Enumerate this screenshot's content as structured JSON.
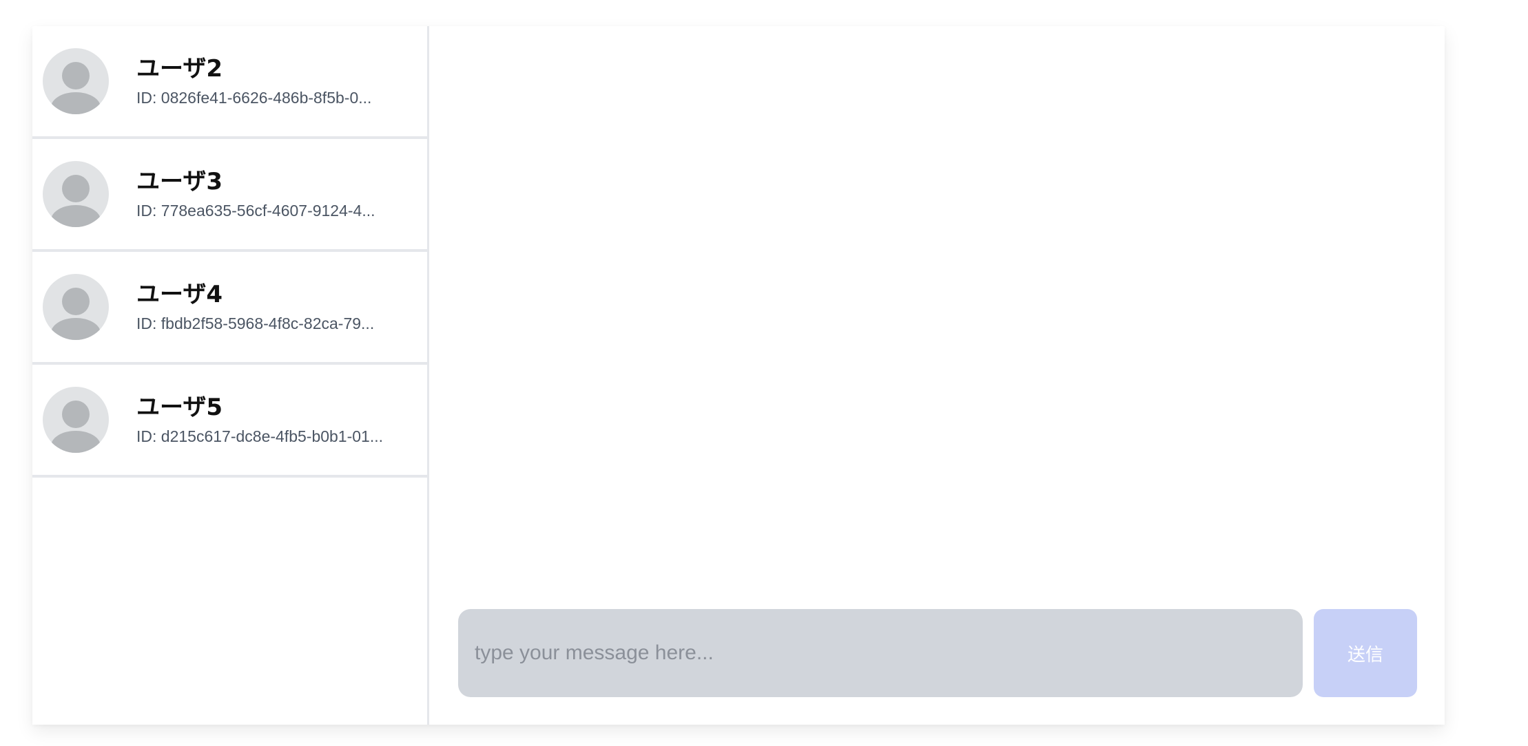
{
  "users": [
    {
      "name": "ユーザ2",
      "id": "ID: 0826fe41-6626-486b-8f5b-0..."
    },
    {
      "name": "ユーザ3",
      "id": "ID: 778ea635-56cf-4607-9124-4..."
    },
    {
      "name": "ユーザ4",
      "id": "ID: fbdb2f58-5968-4f8c-82ca-79..."
    },
    {
      "name": "ユーザ5",
      "id": "ID: d215c617-dc8e-4fb5-b0b1-01..."
    }
  ],
  "composer": {
    "placeholder": "type your message here...",
    "send_label": "送信"
  },
  "colors": {
    "send_button_disabled": "#c7d0f7",
    "input_background": "#d1d5db",
    "avatar_background": "#e1e3e5",
    "divider": "#e5e7eb"
  },
  "icons": {
    "avatar": "user-avatar-icon"
  }
}
